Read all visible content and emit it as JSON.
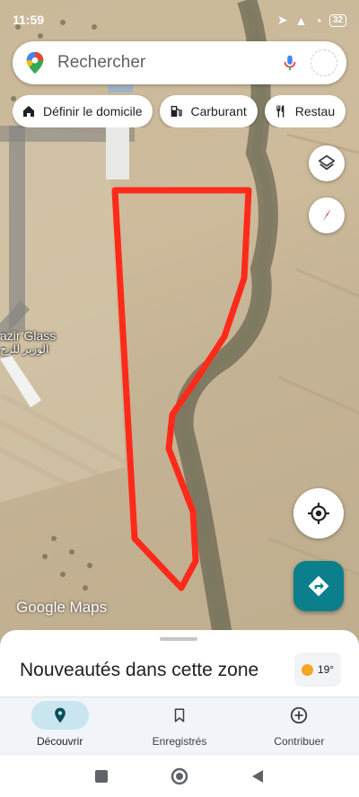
{
  "status_bar": {
    "time": "11:59",
    "battery": "32"
  },
  "search": {
    "placeholder": "Rechercher"
  },
  "chips": [
    {
      "label": "Définir le domicile",
      "icon": "home-icon"
    },
    {
      "label": "Carburant",
      "icon": "gas-station-icon"
    },
    {
      "label": "Restau",
      "icon": "restaurant-icon"
    }
  ],
  "map": {
    "place_label": "azir Glass",
    "place_label_ar": "الوزير للزج",
    "logo": "Google Maps",
    "outline_color": "#ff2a1a"
  },
  "sheet": {
    "title": "Nouveautés dans cette zone",
    "weather_temp": "19°"
  },
  "bottom_nav": [
    {
      "label": "Découvrir",
      "icon": "explore-pin-icon",
      "active": true
    },
    {
      "label": "Enregistrés",
      "icon": "bookmark-icon",
      "active": false
    },
    {
      "label": "Contribuer",
      "icon": "add-circle-icon",
      "active": false
    }
  ],
  "colors": {
    "accent": "#0b7f8b",
    "active_tab": "#c9e6f0"
  }
}
